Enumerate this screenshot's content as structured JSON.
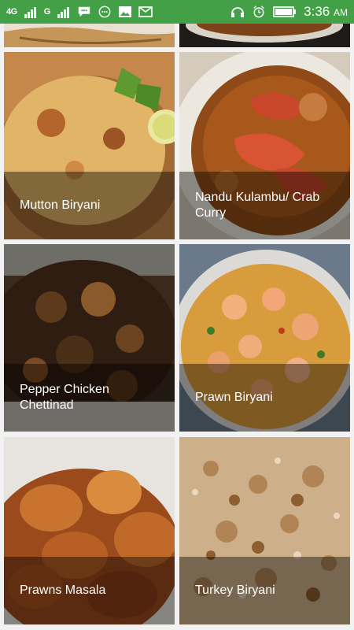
{
  "status": {
    "network": "4G",
    "network2": "G",
    "time": "3:36",
    "ampm": "AM",
    "icons": [
      "signal-icon",
      "signal-icon",
      "chat-icon",
      "message-icon",
      "image-icon",
      "mail-icon",
      "headset-icon",
      "alarm-icon",
      "battery-icon"
    ]
  },
  "recipes": [
    {
      "title": "Mutton Biryani"
    },
    {
      "title": "Nandu Kulambu/ Crab Curry"
    },
    {
      "title": "Pepper Chicken Chettinad"
    },
    {
      "title": "Prawn Biryani"
    },
    {
      "title": "Prawns Masala"
    },
    {
      "title": "Turkey Biryani"
    }
  ],
  "colors": {
    "status_bar": "#43a047",
    "overlay": "rgba(0,0,0,0.42)"
  }
}
